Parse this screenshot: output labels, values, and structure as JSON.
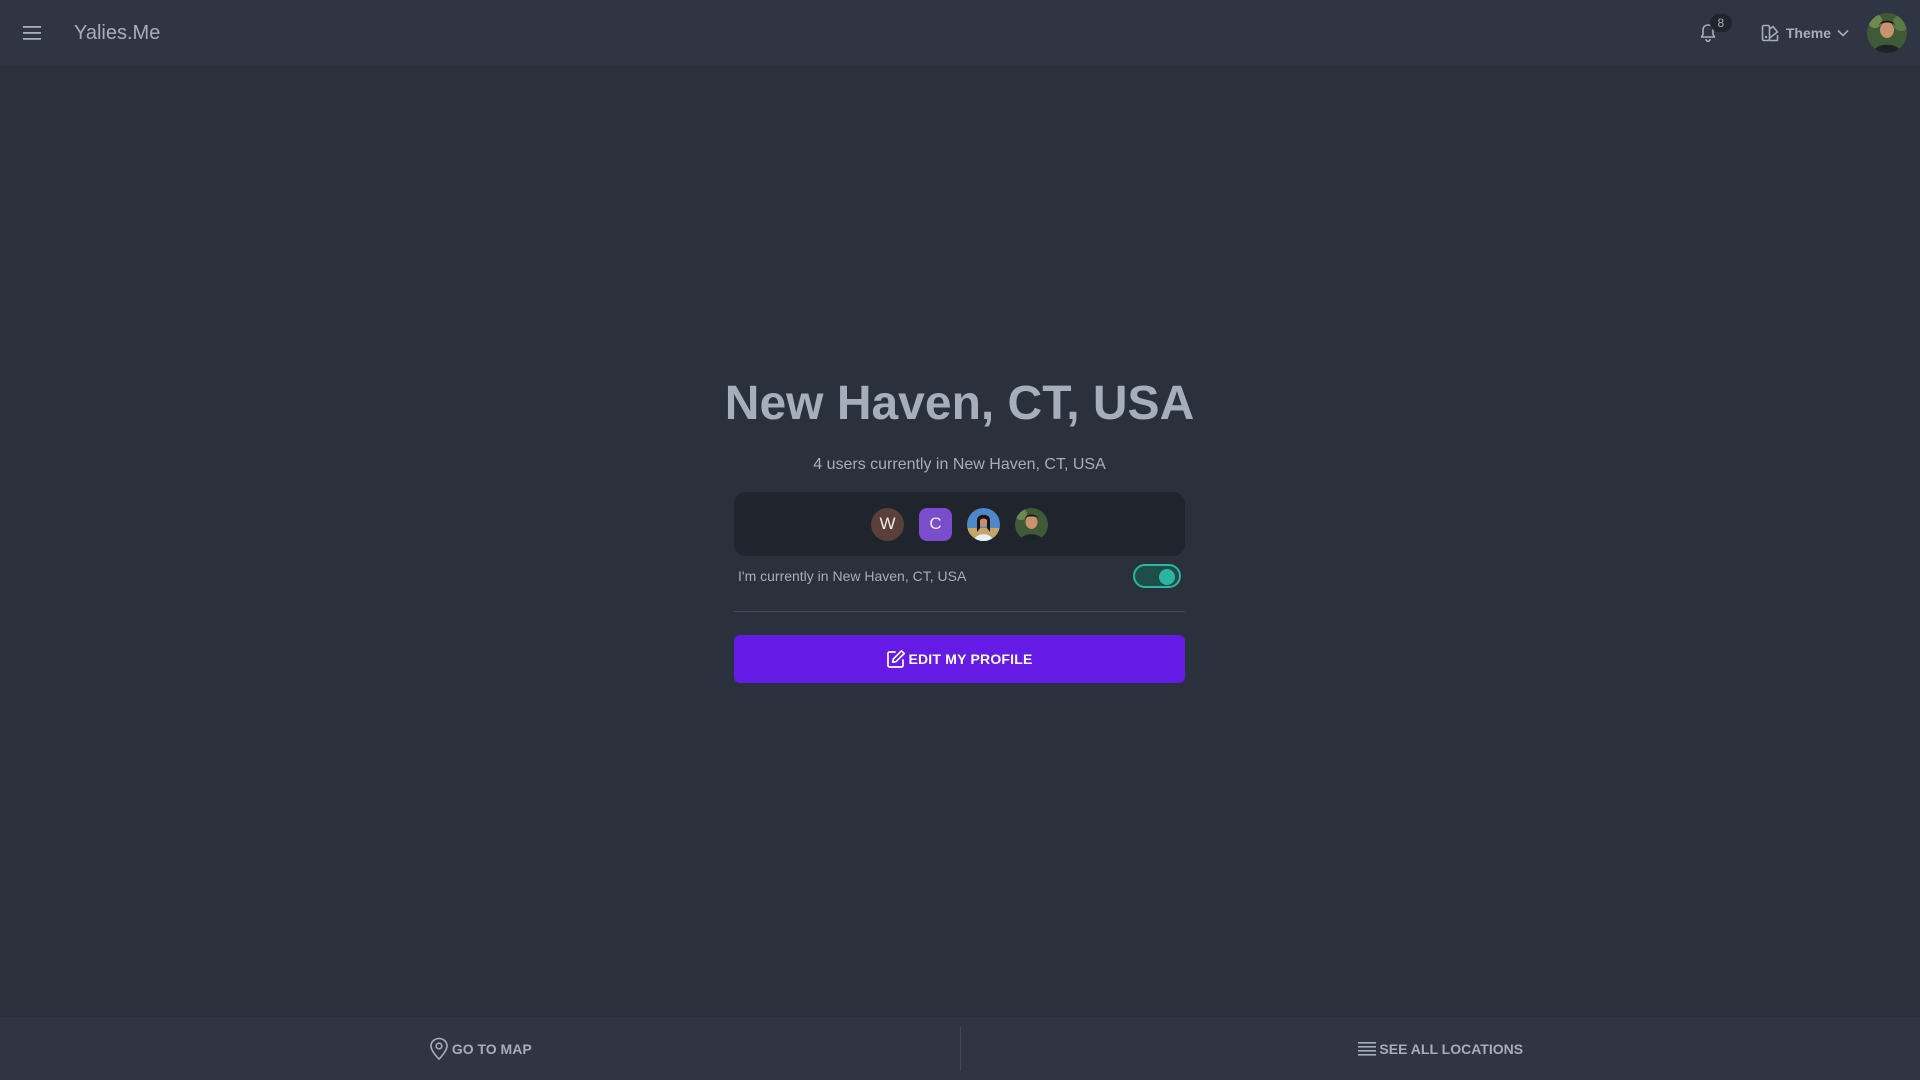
{
  "header": {
    "brand": "Yalies.Me",
    "notification_count": "8",
    "theme_label": "Theme"
  },
  "location": {
    "title": "New Haven, CT, USA",
    "subtitle": "4 users currently in New Haven, CT, USA",
    "users": [
      {
        "initial": "W",
        "color": "#5a3f3a"
      },
      {
        "initial": "C",
        "color": "#7a4dcc"
      },
      {
        "initial": "",
        "type": "photo"
      },
      {
        "initial": "",
        "type": "photo"
      }
    ],
    "toggle_label": "I'm currently in New Haven, CT, USA",
    "toggle_on": true,
    "edit_button": "EDIT MY PROFILE"
  },
  "bottom_nav": {
    "go_to_map": "GO TO MAP",
    "see_all_locations": "SEE ALL LOCATIONS"
  },
  "colors": {
    "background": "#2a303c",
    "navbar": "#2f3542",
    "primary": "#661ae6",
    "accent": "#2cb5a0",
    "text": "#a6adbb"
  }
}
